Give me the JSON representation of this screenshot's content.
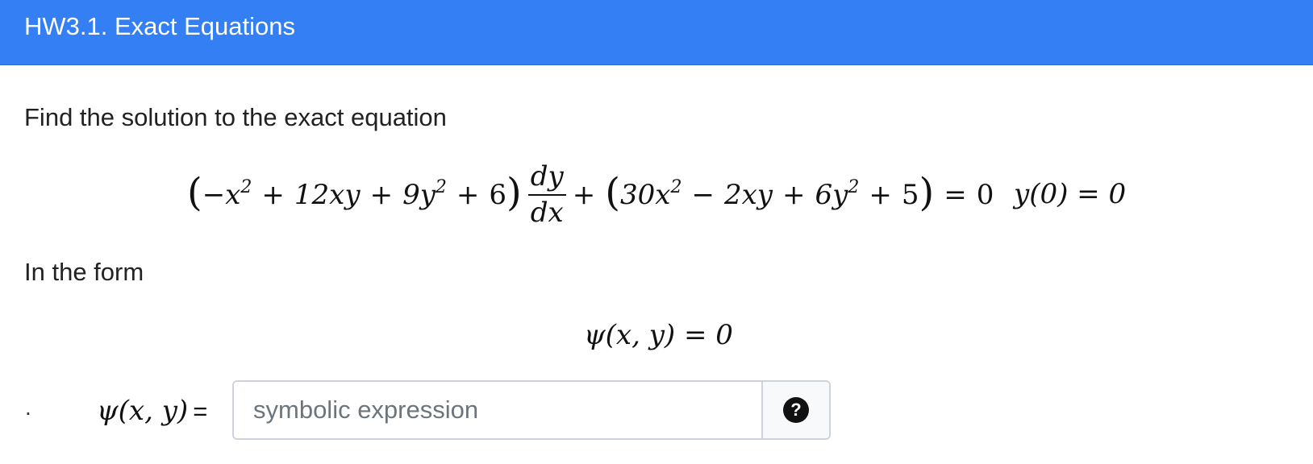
{
  "header": {
    "title": "HW3.1. Exact Equations",
    "background": "#337ff3"
  },
  "question": {
    "intro": "Find the solution to the exact equation",
    "form_text": "In the form",
    "equation": {
      "coef_x2": "−x",
      "term_12xy": "12xy",
      "term_9y2": "9y",
      "const_6": "6",
      "frac_num": "dy",
      "frac_den": "dx",
      "term_30x2": "30x",
      "term_2xy": "2xy",
      "term_6y2": "6y",
      "const_5": "5",
      "rhs": "0",
      "exp": "2"
    },
    "initial_condition": "y(0) = 0",
    "form_equation": "ψ(x, y) = 0"
  },
  "answer": {
    "bullet": ".",
    "label_math": "ψ(x, y)",
    "label_eq": "=",
    "placeholder": "symbolic expression",
    "value": "",
    "help_icon": "question-circle-icon",
    "help_glyph": "?"
  }
}
